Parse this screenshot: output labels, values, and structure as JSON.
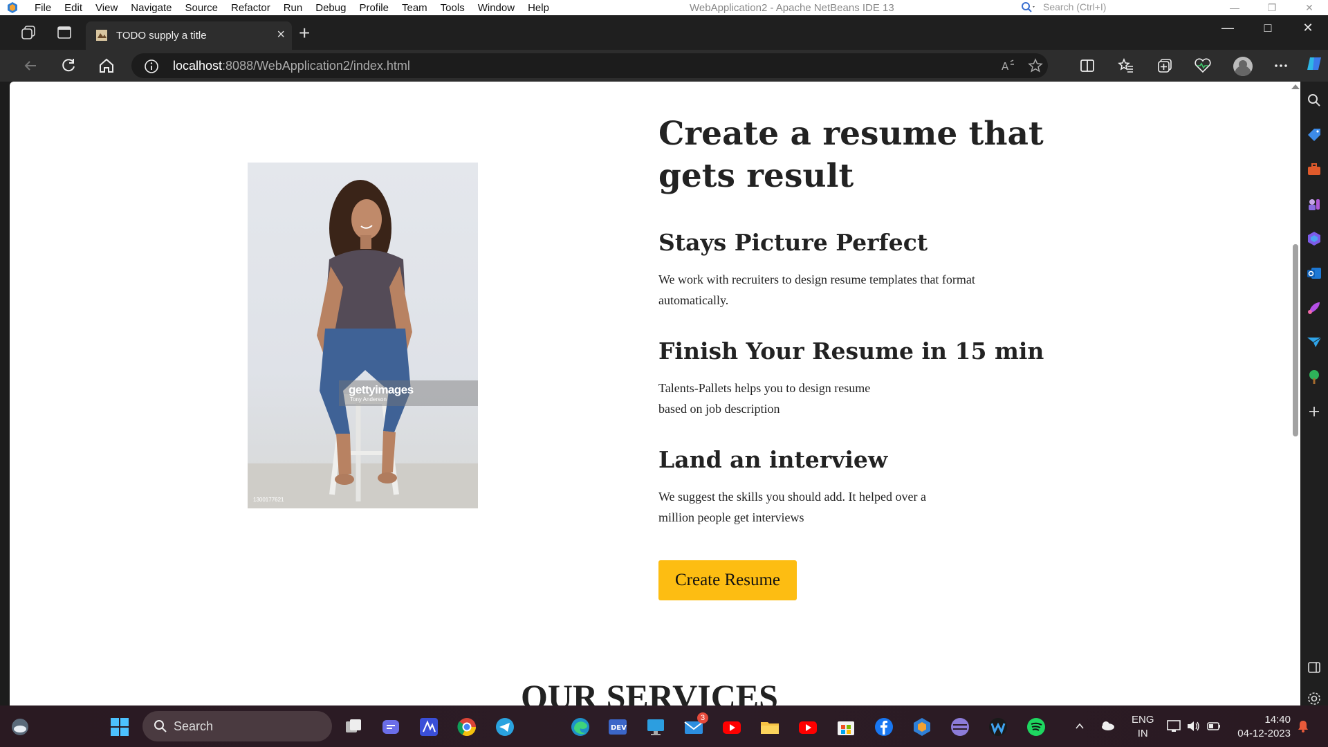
{
  "netbeans": {
    "menu": [
      "File",
      "Edit",
      "View",
      "Navigate",
      "Source",
      "Refactor",
      "Run",
      "Debug",
      "Profile",
      "Team",
      "Tools",
      "Window",
      "Help"
    ],
    "title": "WebApplication2 - Apache NetBeans IDE 13",
    "search_placeholder": "Search (Ctrl+I)"
  },
  "browser": {
    "tab_title": "TODO supply a title",
    "url_host": "localhost",
    "url_path": ":8088/WebApplication2/index.html"
  },
  "page": {
    "headline_line1": "Create a resume that",
    "headline_line2": "gets result",
    "features": [
      {
        "title": "Stays Picture Perfect",
        "text_line1": "We work with recruiters to design resume templates that format",
        "text_line2": "automatically."
      },
      {
        "title": "Finish Your Resume in 15 min",
        "text_line1": "Talents-Pallets helps you to design resume",
        "text_line2": "based on job description"
      },
      {
        "title": "Land an interview",
        "text_line1": "We suggest the skills you should add. It helped over a",
        "text_line2": "million people get interviews"
      }
    ],
    "cta_label": "Create Resume",
    "services_heading": "OUR SERVICES",
    "photo": {
      "brand": "gettyimages",
      "credit": "Tony Anderson",
      "image_id": "1300177621"
    }
  },
  "taskbar": {
    "search_label": "Search",
    "mail_badge": "3",
    "language_line1": "ENG",
    "language_line2": "IN",
    "time": "14:40",
    "date": "04-12-2023"
  },
  "colors": {
    "cta": "#fdbd12",
    "heading": "#222222",
    "browser_chrome": "#2d2d2d"
  }
}
